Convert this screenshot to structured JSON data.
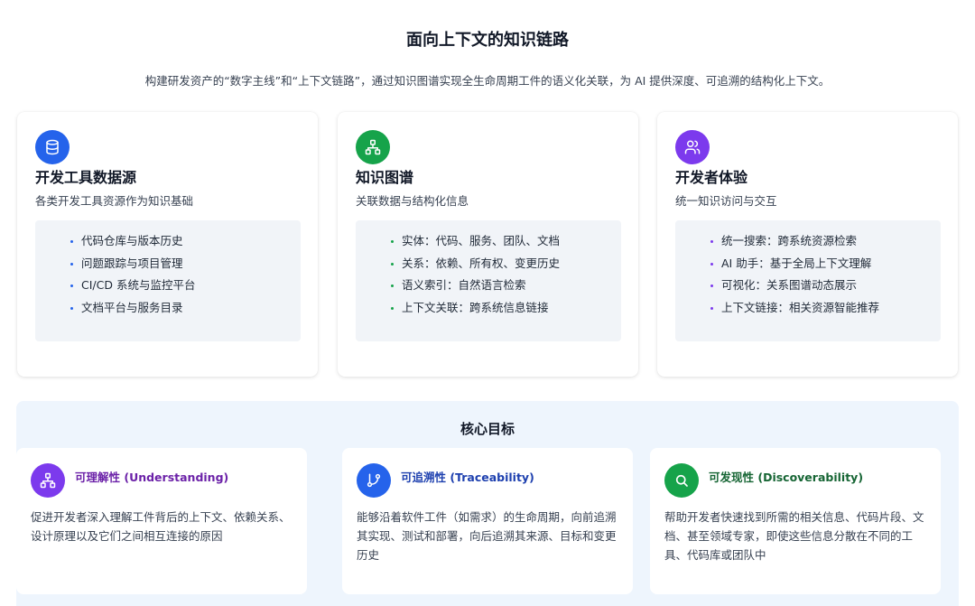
{
  "header": {
    "title": "面向上下文的知识链路",
    "subtitle": "构建研发资产的“数字主线”和“上下文链路”，通过知识图谱实现全生命周期工件的语义化关联，为 AI 提供深度、可追溯的结构化上下文。"
  },
  "colors": {
    "blue": "#2563eb",
    "green": "#16a34a",
    "purple": "#7c3aed",
    "blue_text": "#1e40af",
    "green_text": "#166534",
    "purple_text": "#6b21a8"
  },
  "cards": [
    {
      "icon": "database-icon",
      "title": "开发工具数据源",
      "desc": "各类开发工具资源作为知识基础",
      "items": [
        "代码仓库与版本历史",
        "问题跟踪与项目管理",
        "CI/CD 系统与监控平台",
        "文档平台与服务目录"
      ]
    },
    {
      "icon": "network-icon",
      "title": "知识图谱",
      "desc": "关联数据与结构化信息",
      "items": [
        "实体：代码、服务、团队、文档",
        "关系：依赖、所有权、变更历史",
        "语义索引：自然语言检索",
        "上下文关联：跨系统信息链接"
      ]
    },
    {
      "icon": "users-icon",
      "title": "开发者体验",
      "desc": "统一知识访问与交互",
      "items": [
        "统一搜索：跨系统资源检索",
        "AI 助手：基于全局上下文理解",
        "可视化：关系图谱动态展示",
        "上下文链接：相关资源智能推荐"
      ]
    }
  ],
  "goals": {
    "title": "核心目标",
    "items": [
      {
        "icon": "git-branch-icon",
        "title": "可追溯性 (Traceability)",
        "text": "能够沿着软件工件（如需求）的生命周期，向前追溯其实现、测试和部署，向后追溯其来源、目标和变更历史"
      },
      {
        "icon": "search-icon",
        "title": "可发现性 (Discoverability)",
        "text": "帮助开发者快速找到所需的相关信息、代码片段、文档、甚至领域专家，即使这些信息分散在不同的工具、代码库或团队中"
      },
      {
        "icon": "network-icon",
        "title": "可理解性 (Understanding)",
        "text": "促进开发者深入理解工件背后的上下文、依赖关系、设计原理以及它们之间相互连接的原因"
      }
    ]
  }
}
